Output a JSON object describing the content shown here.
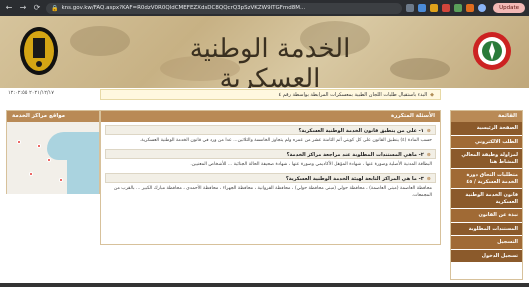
{
  "browser": {
    "url": "kns.gov.kw/FAQ.aspx?KAF=R0dzV0R0QldCMEFEZXdsDC8QQcrQ3pSzVKZW9lTGFmd8M...",
    "update_label": "Update"
  },
  "header": {
    "site_title": "الخدمة الوطنية العسكرية"
  },
  "date_text": "٢٠٢١/١٢/١٧ ١٢:٠٢:٥٥",
  "announcement": "البدء باستقبال طلبات اللجان الطبية بمعسكرات المرابطة بواسطة رقم ٤",
  "map_panel": {
    "title": "مواقع مراكز الخدمة"
  },
  "faq_panel": {
    "title": "الأسئلة المتكررة",
    "items": [
      {
        "question": "١- على من ينطبق قانون الخدمة الوطنية العسكرية؟",
        "answer": "حسب المادة (٤) ينطبق القانون على كل كويتي أتم الثامنة عشر من عمره ولم يتجاوز الخامسة والثلاثين... عدا من ورد في قانون الخدمة الوطنية العسكرية."
      },
      {
        "question": "٢- ماهي المستندات المطلوبة عند مراجعة مراكز الخدمة؟",
        "answer": "البطاقة المدنية الأصلية وصورة عنها ، شهادة المؤهل الأكاديمي وصورة عنها ، شهادة صحيفة الحالة الجنائية ... للأشخاص المعنيين."
      },
      {
        "question": "٣- ما هي المراكز التابعة لهيئة الخدمة الوطنية العسكرية؟",
        "answer": "محافظة العاصمة (مبنى العاصمة) ، محافظة حولي (مبنى محافظة حولي) ، محافظة الفروانية ، محافظة الجهراء ، محافظة الأحمدي ، محافظة مبارك الكبير ... بالقرب من المجمعات."
      }
    ]
  },
  "sidebar": {
    "title": "القائمة",
    "items": [
      "الصفحة الرئيسية",
      "الطلب الالكتروني",
      "لمزاولة وظيفة المعالي المشاط هنا",
      "متطلبات التحاق دورة الخدمة العسكرية / ٤٥",
      "قانون الخدمة الوطنية العسكرية",
      "نبذة عن القانون",
      "المستندات المطلوبة",
      "التسجيل",
      "تسجيل الدخول"
    ]
  }
}
